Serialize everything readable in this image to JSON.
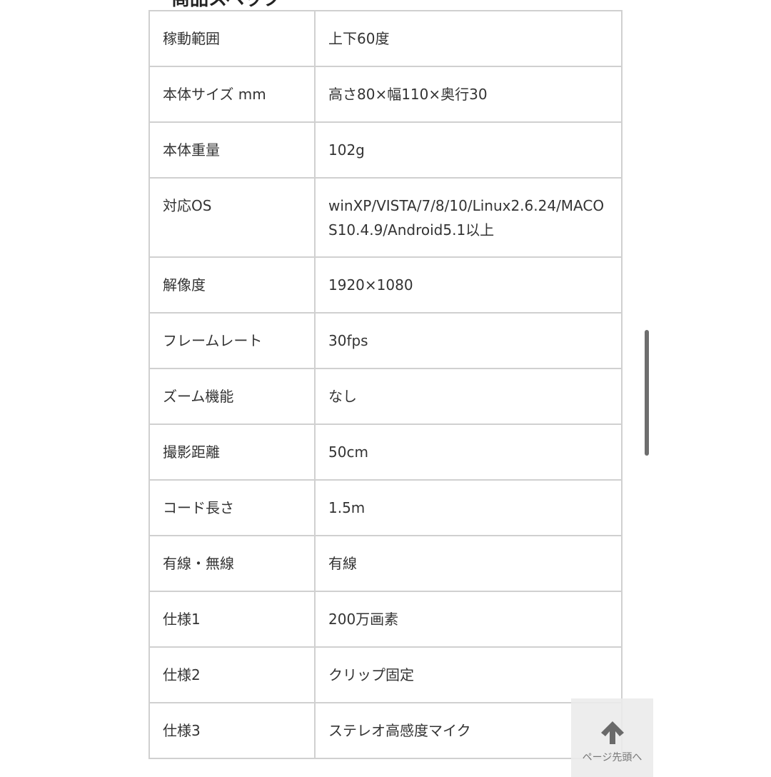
{
  "section_title": "商品スペック",
  "specs": [
    {
      "label": "稼動範囲",
      "value": "上下60度"
    },
    {
      "label": "本体サイズ mm",
      "value": "高さ80×幅110×奥行30"
    },
    {
      "label": "本体重量",
      "value": "102g"
    },
    {
      "label": "対応OS",
      "value": "winXP/VISTA/7/8/10/Linux2.6.24/MACOS10.4.9/Android5.1以上"
    },
    {
      "label": "解像度",
      "value": "1920×1080"
    },
    {
      "label": "フレームレート",
      "value": "30fps"
    },
    {
      "label": "ズーム機能",
      "value": "なし"
    },
    {
      "label": "撮影距離",
      "value": "50cm"
    },
    {
      "label": "コード長さ",
      "value": "1.5m"
    },
    {
      "label": "有線・無線",
      "value": "有線"
    },
    {
      "label": "仕様1",
      "value": "200万画素"
    },
    {
      "label": "仕様2",
      "value": "クリップ固定"
    },
    {
      "label": "仕様3",
      "value": "ステレオ高感度マイク"
    }
  ],
  "page_top": {
    "label": "ページ先頭へ",
    "icon": "arrow-up-icon"
  }
}
